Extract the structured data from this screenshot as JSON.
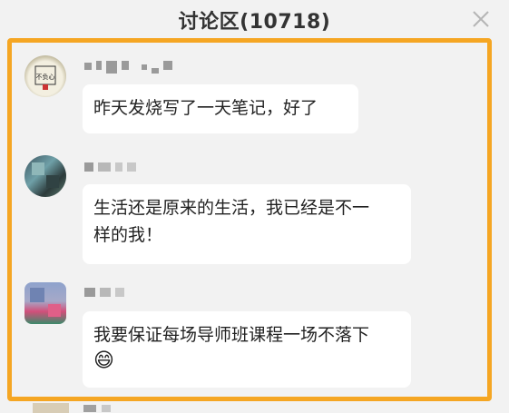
{
  "header": {
    "title": "讨论区(10718)"
  },
  "messages": [
    {
      "text": "昨天发烧写了一天笔记，好了",
      "avatar_text": "不负心"
    },
    {
      "line1": "生活还是原来的生活，我已经是不一",
      "line2": "样的我！"
    },
    {
      "text": "我要保证每场导师班课程一场不落下",
      "emoji": "😄"
    }
  ],
  "colors": {
    "highlight_border": "#f5a623",
    "bubble_bg": "#ffffff"
  }
}
